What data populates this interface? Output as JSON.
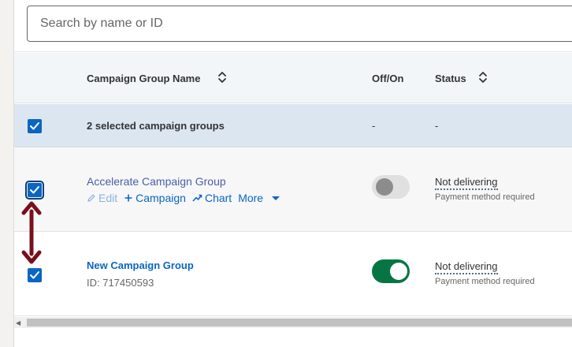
{
  "search": {
    "placeholder": "Search by name or ID"
  },
  "table": {
    "headers": {
      "name": "Campaign Group Name",
      "offon": "Off/On",
      "status": "Status"
    },
    "selection": {
      "label": "2 selected campaign groups",
      "offon": "-",
      "status": "-"
    },
    "rows": [
      {
        "name": "Accelerate Campaign Group",
        "actions": {
          "edit": "Edit",
          "campaign": "Campaign",
          "chart": "Chart",
          "more": "More"
        },
        "toggle": "off",
        "status": "Not delivering",
        "status_detail": "Payment method required"
      },
      {
        "name": "New Campaign Group",
        "id_text": "ID: 717450593",
        "toggle": "on",
        "status": "Not delivering",
        "status_detail": "Payment method required"
      }
    ]
  },
  "colors": {
    "accent": "#0a66c2",
    "toggle_on": "#057642",
    "annotation": "#7a0f1c"
  },
  "icons": [
    "sort-icon",
    "checkmark-icon",
    "pencil-icon",
    "plus-icon",
    "chart-icon",
    "caret-down-icon",
    "double-arrow-icon"
  ]
}
